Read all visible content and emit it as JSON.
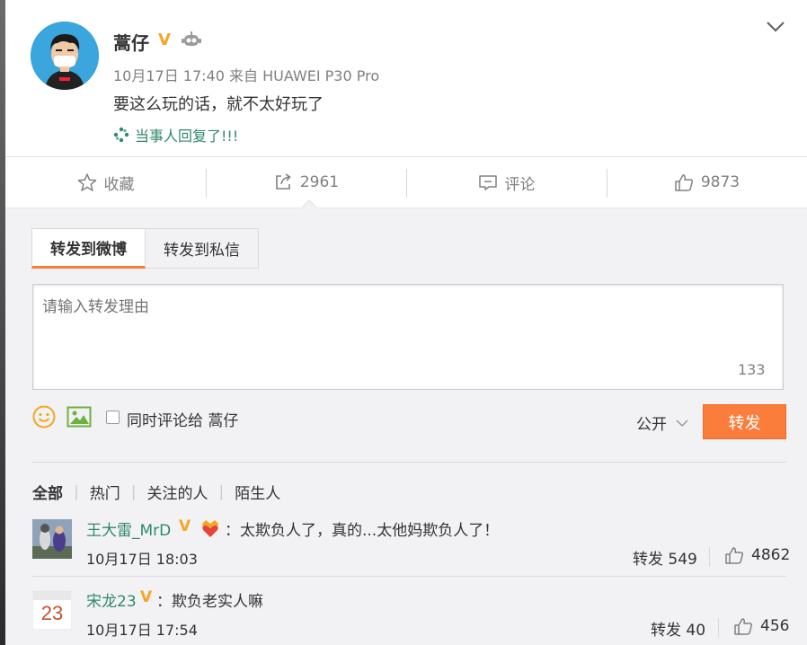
{
  "post": {
    "username": "蒿仔",
    "verified_mark": "V",
    "meta": "10月17日 17:40 来自 HUAWEI P30 Pro",
    "text": "要这么玩的话，就不太好玩了",
    "reply_note": "当事人回复了!!!"
  },
  "actions": {
    "favorite": "收藏",
    "repost_count": "2961",
    "comment": "评论",
    "like_count": "9873"
  },
  "repost_panel": {
    "tab_weibo": "转发到微博",
    "tab_private": "转发到私信",
    "input_placeholder": "请输入转发理由",
    "char_counter": "133",
    "also_comment_label": "同时评论给 蒿仔",
    "privacy": "公开",
    "submit": "转发"
  },
  "filters": {
    "all": "全部",
    "hot": "热门",
    "following": "关注的人",
    "strangers": "陌生人"
  },
  "reposts": [
    {
      "username": "王大雷_MrD",
      "badge": "V",
      "text": "：太欺负人了，真的...太他妈欺负人了！",
      "time": "10月17日 18:03",
      "repost_label": "转发 549",
      "like_count": "4862"
    },
    {
      "username": "宋龙23",
      "badge": "V",
      "text": "：欺负老实人嘛",
      "time": "10月17日 17:54",
      "repost_label": "转发 40",
      "like_count": "456",
      "avatar_text": "23"
    }
  ],
  "colors": {
    "accent": "#fa7d3c",
    "link_green": "#2f8a6b",
    "verified_gold": "#f5a623",
    "panel_bg": "#f2f2f5"
  },
  "icons": [
    "chevron-down-icon",
    "star-icon",
    "share-icon",
    "comment-icon",
    "thumbs-up-icon",
    "emoji-icon",
    "image-icon",
    "robot-icon",
    "pinwheel-icon"
  ]
}
